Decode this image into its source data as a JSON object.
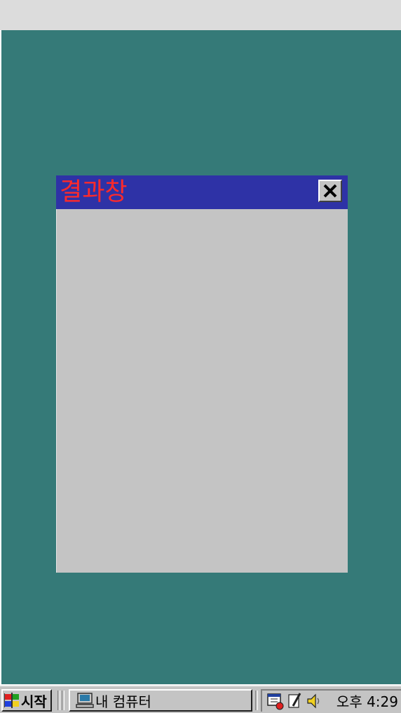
{
  "window": {
    "title": "결과창",
    "close_icon": "close-icon"
  },
  "taskbar": {
    "start_label": "시작",
    "start_icon": "windows-logo-icon",
    "task_label": "내 컴퓨터",
    "task_icon": "my-computer-icon",
    "tray_icons": [
      "scheduler-icon",
      "pen-icon",
      "speaker-icon"
    ],
    "clock": "오후 4:29"
  },
  "colors": {
    "desktop": "#357a78",
    "titlebar": "#2e32a6",
    "title_text": "#ff2a2a",
    "window_body": "#c4c4c4"
  }
}
